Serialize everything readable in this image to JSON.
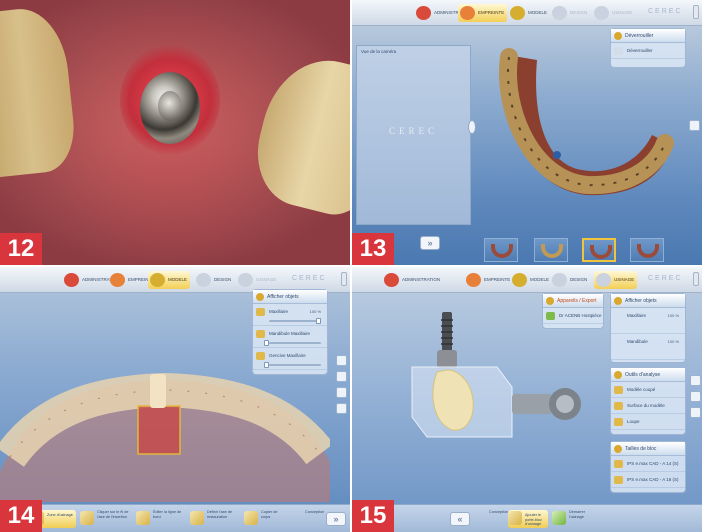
{
  "figure_numbers": [
    "12",
    "13",
    "14",
    "15"
  ],
  "brand": "CEREC",
  "tabs": [
    "ADMINISTRATION",
    "EMPREINTE",
    "MODELE",
    "DESIGN",
    "USINAGE"
  ],
  "screen13": {
    "camera_view_title": "Vue de la caméra",
    "panel_title": "Déverrouiller",
    "panel_item": "Déverrouiller"
  },
  "screen14": {
    "panel_title": "Afficher objets",
    "objects": [
      {
        "label": "Maxillaire",
        "value": "100 %",
        "opacity": 1.0
      },
      {
        "label": "Mandibule Maxillaire",
        "value": "",
        "opacity": 0.0
      },
      {
        "label": "Gencive Maxillaire",
        "value": "",
        "opacity": 0.0
      }
    ],
    "steps": [
      "Zone d'usinage",
      "Cliquer sur le fil de l'axe de l'insertion",
      "Éditer la ligne de bord",
      "Définir l'axe de restauration",
      "Copier de corps",
      "Conception"
    ]
  },
  "screen15": {
    "library_title": "Appareils / Export",
    "library_item": "Dr ACENB Hostpièce",
    "objects_title": "Afficher objets",
    "objects": [
      {
        "label": "Maxillaire",
        "value": "100 %"
      },
      {
        "label": "Mandibule",
        "value": "100 %"
      }
    ],
    "tools_title": "Outils d'analyse",
    "tools": [
      "Modèle coupé",
      "Surface du modèle",
      "Loupe"
    ],
    "blocks_title": "Tailles de bloc",
    "blocks": [
      "IPS e.max CAD - A 14 (S)",
      "IPS e.max CAD - A 16 (S)"
    ],
    "steps": [
      "Conception",
      "Ajouter le porte-bloc d'usinage",
      "Démarrer l'usinage"
    ]
  },
  "colors": {
    "badge": "#d8353d",
    "active_tab": "#f2cf56"
  }
}
